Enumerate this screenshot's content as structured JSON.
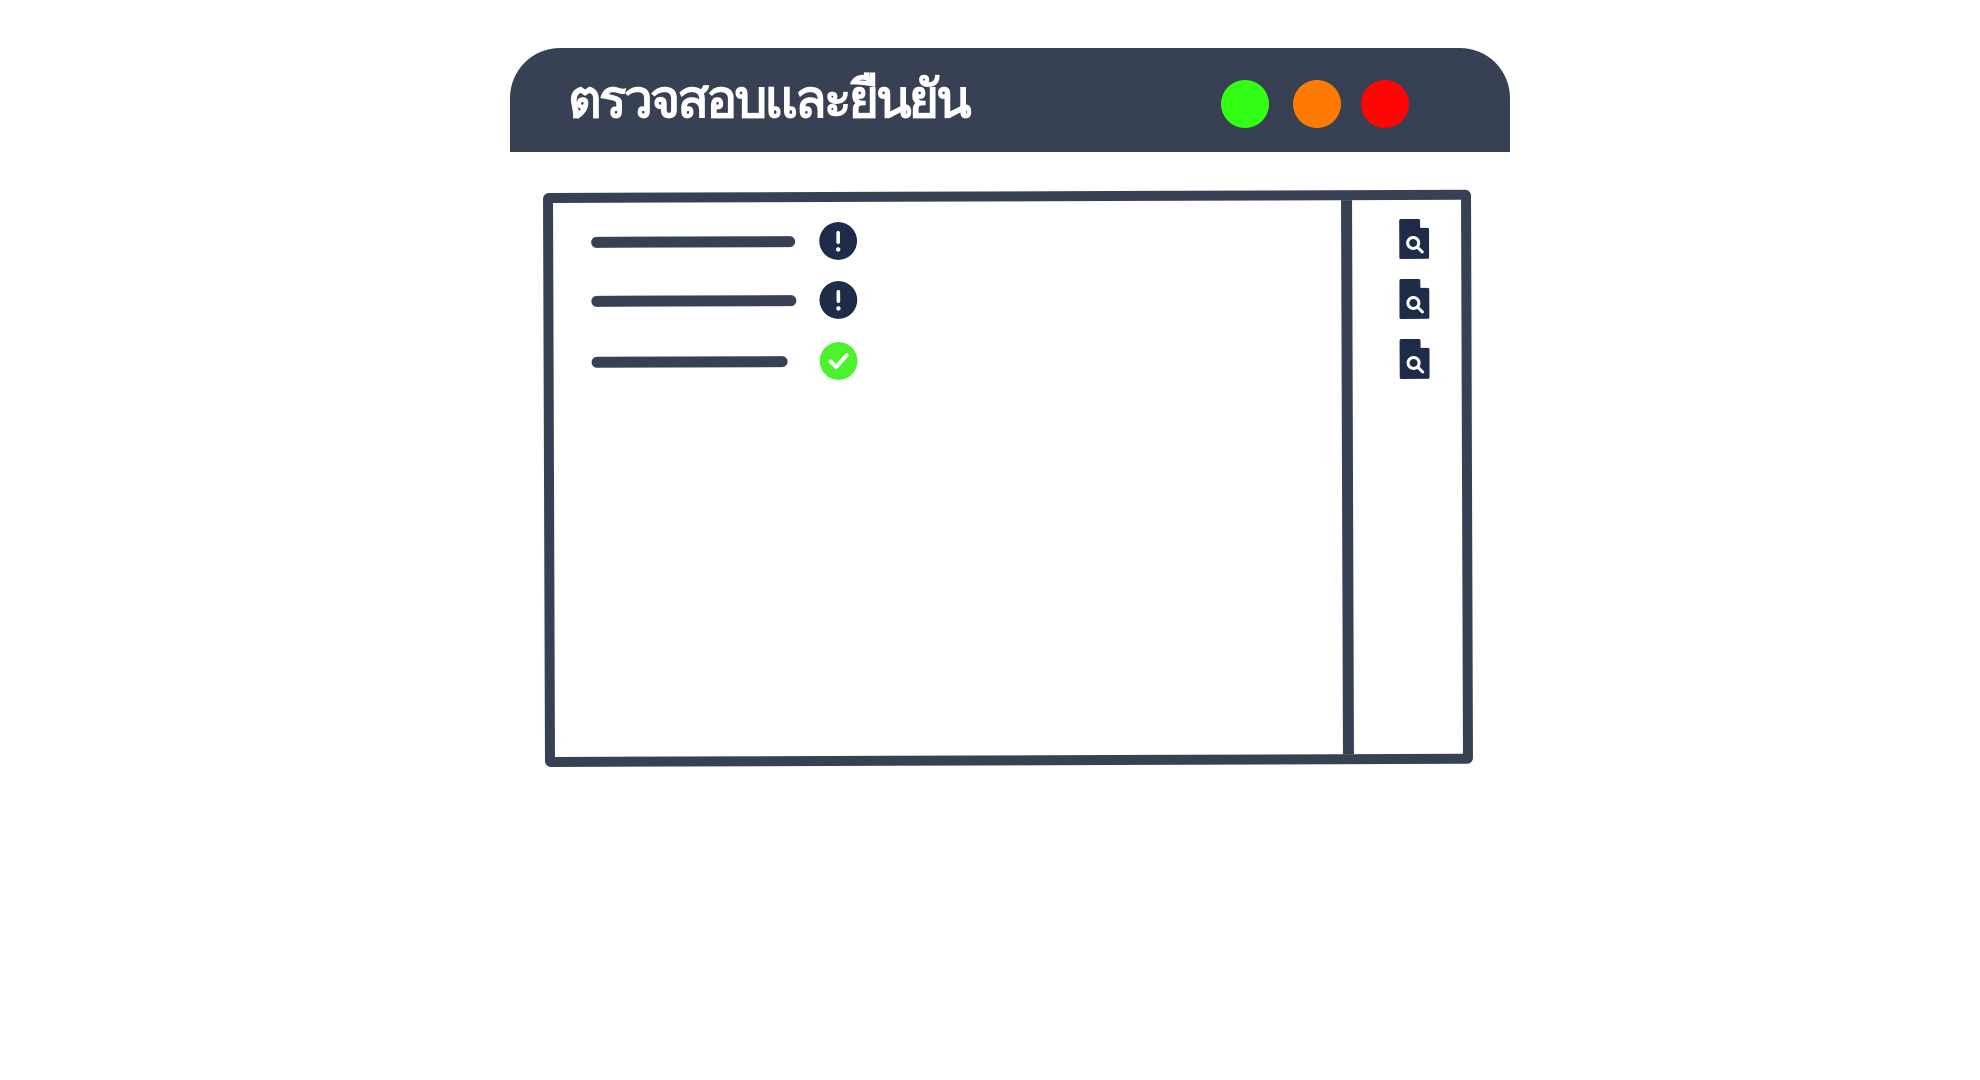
{
  "window": {
    "title": "ตรวจสอบและยืนยัน",
    "controls": {
      "green": "#33ff14",
      "orange": "#ff7a00",
      "red": "#ff0505"
    },
    "frame_color": "#384154"
  },
  "checklist": {
    "items": [
      {
        "status": "warning",
        "status_icon": "exclamation-circle-icon",
        "status_color": "#1e2c49",
        "action_icon": "document-search-icon"
      },
      {
        "status": "warning",
        "status_icon": "exclamation-circle-icon",
        "status_color": "#1e2c49",
        "action_icon": "document-search-icon"
      },
      {
        "status": "verified",
        "status_icon": "check-circle-icon",
        "status_color": "#4cf22e",
        "action_icon": "document-search-icon"
      }
    ]
  }
}
